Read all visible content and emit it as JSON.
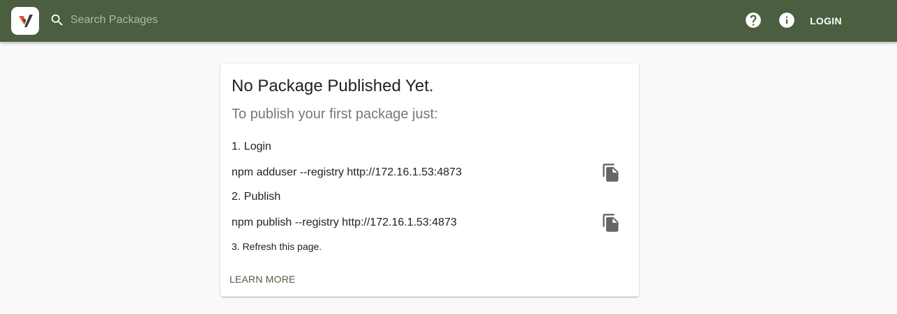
{
  "header": {
    "search_placeholder": "Search Packages",
    "login_label": "LOGIN"
  },
  "colors": {
    "header_bg": "#4b5e40",
    "page_bg": "#f9f9f9",
    "logo_accent": "#e3542a",
    "logo_dark": "#3b3b3b"
  },
  "icons": {
    "logo": "verdaccio-logo",
    "search": "search-icon",
    "help": "help-circle-icon",
    "info": "info-circle-icon",
    "copy": "copy-file-icon"
  },
  "card": {
    "title": "No Package Published Yet.",
    "subtitle": "To publish your first package just:",
    "steps": [
      {
        "label": "1. Login",
        "command": "npm adduser --registry http://172.16.1.53:4873"
      },
      {
        "label": "2. Publish",
        "command": "npm publish --registry http://172.16.1.53:4873"
      }
    ],
    "step3": "3. Refresh this page.",
    "learn_more": "LEARN MORE"
  }
}
